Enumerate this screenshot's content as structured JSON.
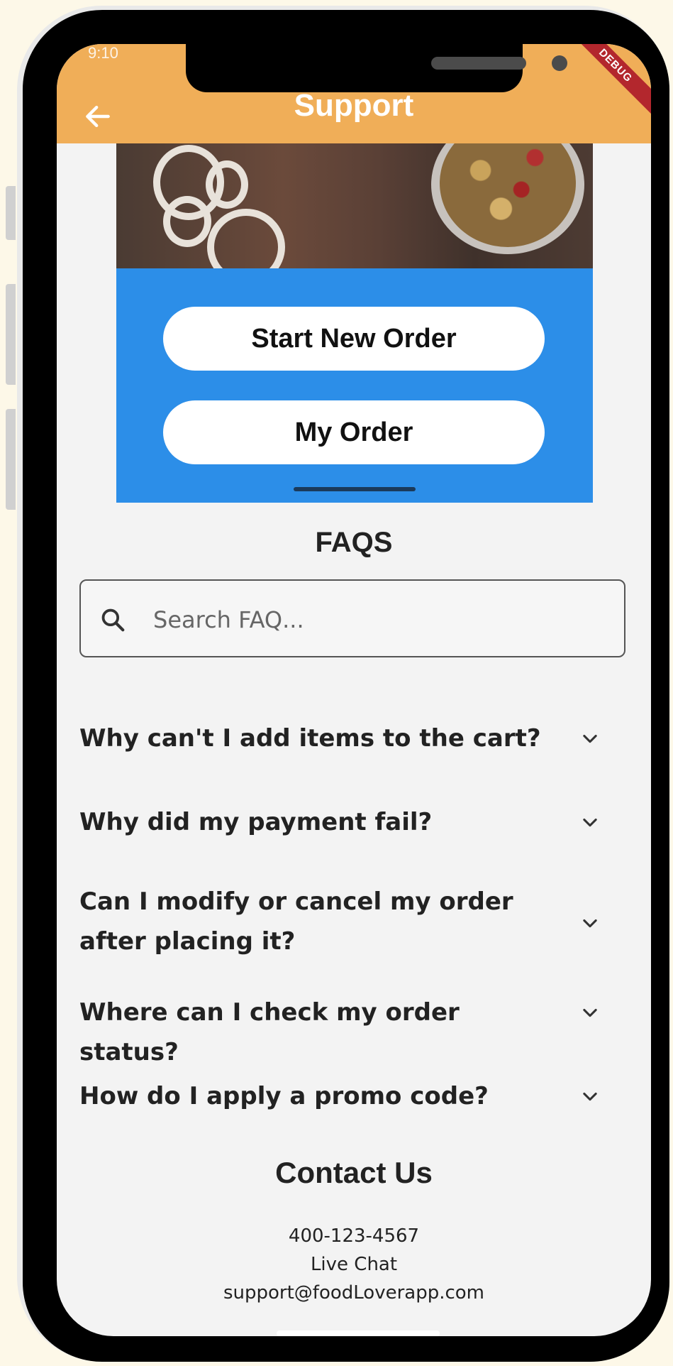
{
  "appbar": {
    "title": "Support",
    "status_time": "9:10",
    "debug_label": "DEBUG"
  },
  "actions": {
    "start_new_order": "Start New Order",
    "my_order": "My Order"
  },
  "faqs": {
    "title": "FAQS",
    "search_placeholder": "Search FAQ...",
    "items": [
      {
        "question": "Why can't I add items to the cart?"
      },
      {
        "question": "Why did my payment fail?"
      },
      {
        "question": "Can I modify or cancel my order after placing it?"
      },
      {
        "question": "Where can I check my order status?"
      },
      {
        "question": "How do I apply a promo code?"
      }
    ]
  },
  "contact": {
    "title": "Contact Us",
    "phone": "400-123-4567",
    "chat": "Live Chat",
    "email": "support@foodLoverapp.com"
  },
  "colors": {
    "appbar": "#f0ae58",
    "panel": "#2c8ee8",
    "background": "#f3f3f3"
  }
}
